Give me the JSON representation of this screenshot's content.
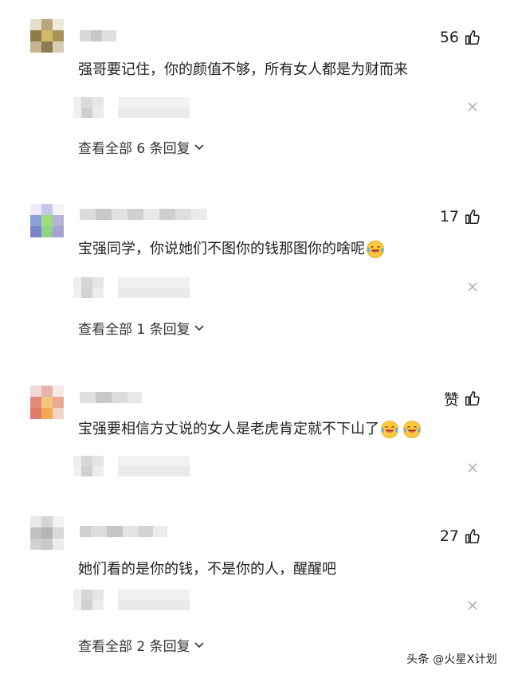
{
  "comments": [
    {
      "likes": "56",
      "text": "强哥要记住，你的颜值不够，所有女人都是为财而来",
      "replies_label": "查看全部 6 条回复",
      "emoji_count": 0
    },
    {
      "likes": "17",
      "text": "宝强同学，你说她们不图你的钱那图你的啥呢",
      "replies_label": "查看全部 1 条回复",
      "emoji_count": 1
    },
    {
      "likes": "赞",
      "text": "宝强要相信方丈说的女人是老虎肯定就不下山了",
      "replies_label": "",
      "emoji_count": 2
    },
    {
      "likes": "27",
      "text": "她们看的是你的钱，不是你的人，醒醒吧",
      "replies_label": "查看全部 2 条回复",
      "emoji_count": 0
    }
  ],
  "icons": {
    "like": "thumbs-up-icon",
    "close": "close-icon",
    "chevron": "chevron-down-icon",
    "emoji": "laughing-crying-emoji-icon"
  },
  "watermark": {
    "text": "头条 @火星X计划"
  },
  "colors": {
    "text": "#222222",
    "muted": "#999999",
    "background": "#ffffff"
  }
}
